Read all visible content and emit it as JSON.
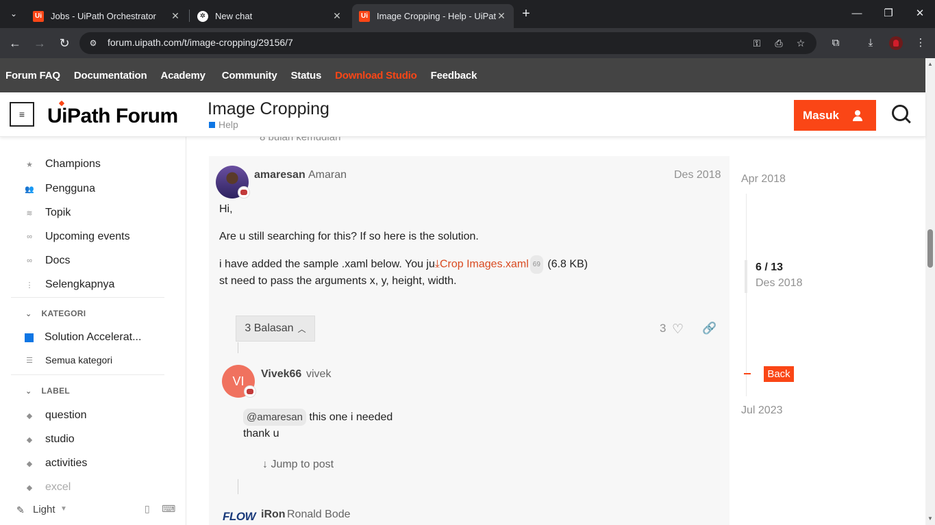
{
  "browser": {
    "tabs": [
      {
        "title": "Jobs - UiPath Orchestrator",
        "icon": "uipath-favicon-icon"
      },
      {
        "title": "New chat",
        "icon": "openai-favicon-icon"
      },
      {
        "title": "Image Cropping - Help - UiPath",
        "icon": "uipath-favicon-icon",
        "active": true
      }
    ],
    "url": "forum.uipath.com/t/image-cropping/29156/7"
  },
  "forum_nav": {
    "items": [
      "Forum FAQ",
      "Documentation",
      "Academy",
      "Community",
      "Status",
      "Download Studio",
      "Feedback"
    ],
    "highlight_color": "#fa4616"
  },
  "header": {
    "logo_text": "UiPath Forum",
    "topic_title": "Image Cropping",
    "topic_category": "Help",
    "login_label": "Masuk"
  },
  "sidebar": {
    "items": [
      "Champions",
      "Pengguna",
      "Topik",
      "Upcoming events",
      "Docs",
      "Selengkapnya"
    ],
    "categories_heading": "KATEGORI",
    "categories": [
      "Solution Accelerat...",
      "Semua kategori"
    ],
    "labels_heading": "LABEL",
    "labels": [
      "question",
      "studio",
      "activities",
      "excel"
    ],
    "theme": "Light"
  },
  "posts": {
    "faded_above": "8 bulan kemudian",
    "main": {
      "username": "amaresan",
      "fullname": "Amaran",
      "date": "Des 2018",
      "line1": "Hi,",
      "line2": "Are u still searching for this? If so here is the solution.",
      "line3_pre": "i have added the sample .xaml below. You ju",
      "attachment": "Crop Images.xaml",
      "attachment_count": "69",
      "attachment_size": "(6.8 KB)",
      "line4": "st need to pass the arguments x, y, height, width.",
      "replies_label": "3 Balasan",
      "likes": "3"
    },
    "reply1": {
      "username": "Vivek66",
      "fullname": "vivek",
      "avatar_initials": "VI",
      "mention": "@amaresan",
      "text1": "this one i needed",
      "text2": "thank u",
      "jump_label": "Jump to post"
    },
    "reply2": {
      "username": "iRon",
      "fullname": "Ronald Bode",
      "logo_text": "FLOW"
    }
  },
  "timeline": {
    "top_date": "Apr 2018",
    "position": "6 / 13",
    "position_date": "Des 2018",
    "back_label": "Back",
    "bottom_date": "Jul 2023"
  }
}
